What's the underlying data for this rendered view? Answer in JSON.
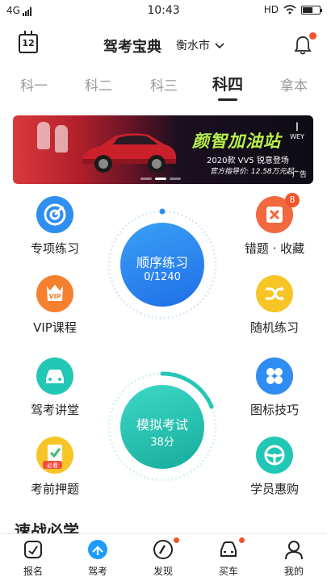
{
  "status": {
    "network": "4G",
    "time": "10:43",
    "hd": "HD"
  },
  "header": {
    "calendar_day": "12",
    "title": "驾考宝典",
    "city": "衡水市"
  },
  "tabs": [
    {
      "label": "科一"
    },
    {
      "label": "科二"
    },
    {
      "label": "科三"
    },
    {
      "label": "科四",
      "active": true
    },
    {
      "label": "拿本"
    }
  ],
  "banner": {
    "title": "颜智加油站",
    "subtitle": "2020款 VV5  锐意登场",
    "price": "官方指导价: 12.58万元起",
    "logo": "WEY",
    "ad_label": "广告"
  },
  "features_left": [
    {
      "label": "专项练习",
      "icon": "target-icon"
    },
    {
      "label": "VIP课程",
      "icon": "vip-icon",
      "icon_text": "VIP"
    },
    {
      "label": "驾考讲堂",
      "icon": "car-icon"
    },
    {
      "label": "考前押题",
      "icon": "checklist-icon",
      "icon_text": "必看"
    }
  ],
  "features_right": [
    {
      "label": "错题 · 收藏",
      "icon": "wrong-book-icon",
      "badge": "8"
    },
    {
      "label": "随机练习",
      "icon": "shuffle-icon"
    },
    {
      "label": "图标技巧",
      "icon": "grid-icon"
    },
    {
      "label": "学员惠购",
      "icon": "steering-wheel-icon"
    }
  ],
  "practice": {
    "label": "顺序练习",
    "progress": "0/1240"
  },
  "exam": {
    "label": "模拟考试",
    "score": "38分"
  },
  "section": {
    "title": "速战必学"
  },
  "bottom_nav": [
    {
      "label": "报名",
      "icon": "signup-icon"
    },
    {
      "label": "驾考",
      "icon": "plane-icon",
      "active": true
    },
    {
      "label": "发现",
      "icon": "compass-icon",
      "dot": true
    },
    {
      "label": "买车",
      "icon": "car-front-icon",
      "dot": true
    },
    {
      "label": "我的",
      "icon": "user-icon"
    }
  ],
  "colors": {
    "accent": "#1e9bff",
    "badge": "#f2542d",
    "practice": "#2f8cf0",
    "exam": "#26c6b6"
  }
}
